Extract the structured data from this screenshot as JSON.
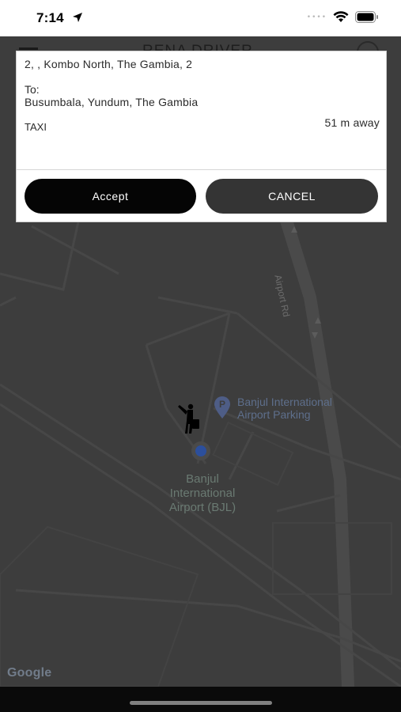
{
  "status_bar": {
    "time": "7:14",
    "signal_dots": "••••",
    "icons": [
      "location-arrow-icon",
      "wifi-icon",
      "battery-icon"
    ]
  },
  "header": {
    "title": "RENA DRIVER"
  },
  "request_card": {
    "pickup_address": "2, , Kombo North, The Gambia,  2",
    "to_label": "To:",
    "destination": "Busumbala, Yundum, The Gambia",
    "ride_type": "TAXI",
    "distance": "51 m away",
    "accept_label": "Accept",
    "cancel_label": "CANCEL"
  },
  "map": {
    "road_label": "Airport Rd",
    "poi_label_line1": "Banjul International",
    "poi_label_line2": "Airport Parking",
    "airport_line1": "Banjul",
    "airport_line2": "International",
    "airport_line3": "Airport (BJL)",
    "attribution": "Google"
  },
  "colors": {
    "map_overlay": "#3d3d3d",
    "accept_button": "#050505",
    "cancel_button": "#343434",
    "user_location": "#2c4f9c"
  }
}
